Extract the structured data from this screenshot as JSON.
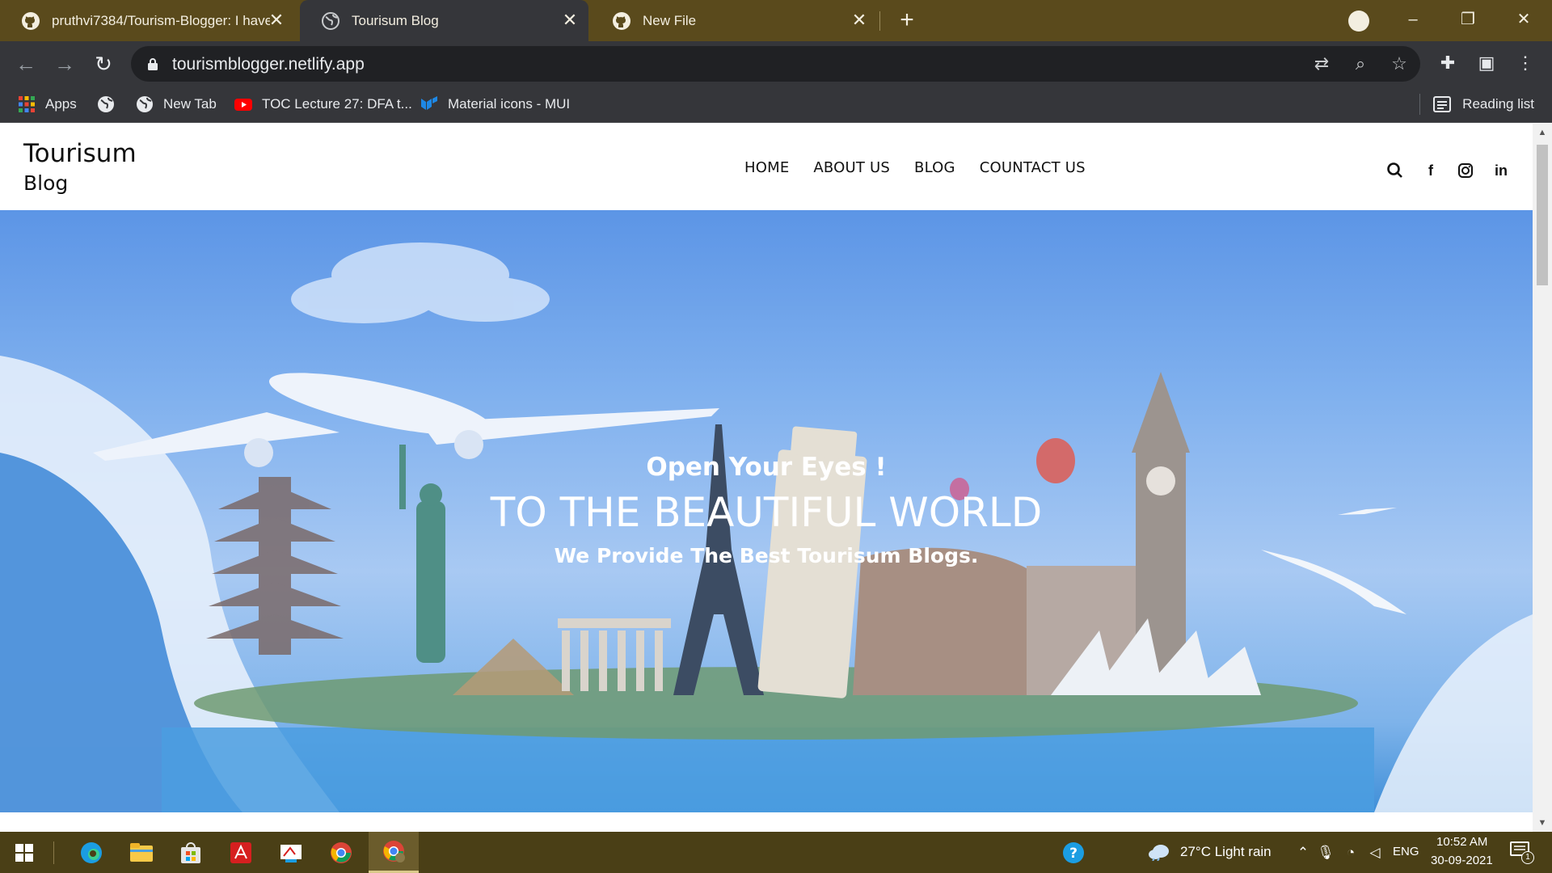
{
  "browser": {
    "tabs": [
      {
        "title": "pruthvi7384/Tourism-Blogger: I have",
        "icon": "github-icon"
      },
      {
        "title": "Tourisum Blog",
        "icon": "globe-icon",
        "active": true
      },
      {
        "title": "New File",
        "icon": "github-icon"
      }
    ],
    "url": "tourismblogger.netlify.app",
    "bookmarks": [
      {
        "label": "Apps",
        "icon": "apps-grid-icon"
      },
      {
        "label": "",
        "icon": "globe-icon"
      },
      {
        "label": "New Tab",
        "icon": "globe-icon"
      },
      {
        "label": "TOC Lecture 27: DFA t...",
        "icon": "youtube-icon"
      },
      {
        "label": "Material icons - MUI",
        "icon": "mui-icon"
      }
    ],
    "reading_list": "Reading list"
  },
  "site": {
    "logo_line1": "Tourisum",
    "logo_line2": "Blog",
    "nav": [
      "HOME",
      "ABOUT US",
      "BLOG",
      "COUNTACT US"
    ],
    "social_icons": [
      "search-icon",
      "facebook-icon",
      "instagram-icon",
      "linkedin-icon"
    ],
    "hero": {
      "kicker": "Open Your Eyes !",
      "title": "TO THE BEAUTIFUL WORLD",
      "subtitle": "We Provide The Best Tourisum Blogs."
    }
  },
  "taskbar": {
    "weather": "27°C  Light rain",
    "language": "ENG",
    "time": "10:52 AM",
    "date": "30-09-2021",
    "notification_count": "1"
  },
  "colors": {
    "tabbar": "#5a4a1c",
    "toolbar": "#35363a",
    "taskbar": "#4a3f16",
    "hero_sky": "#7fb0ee"
  }
}
